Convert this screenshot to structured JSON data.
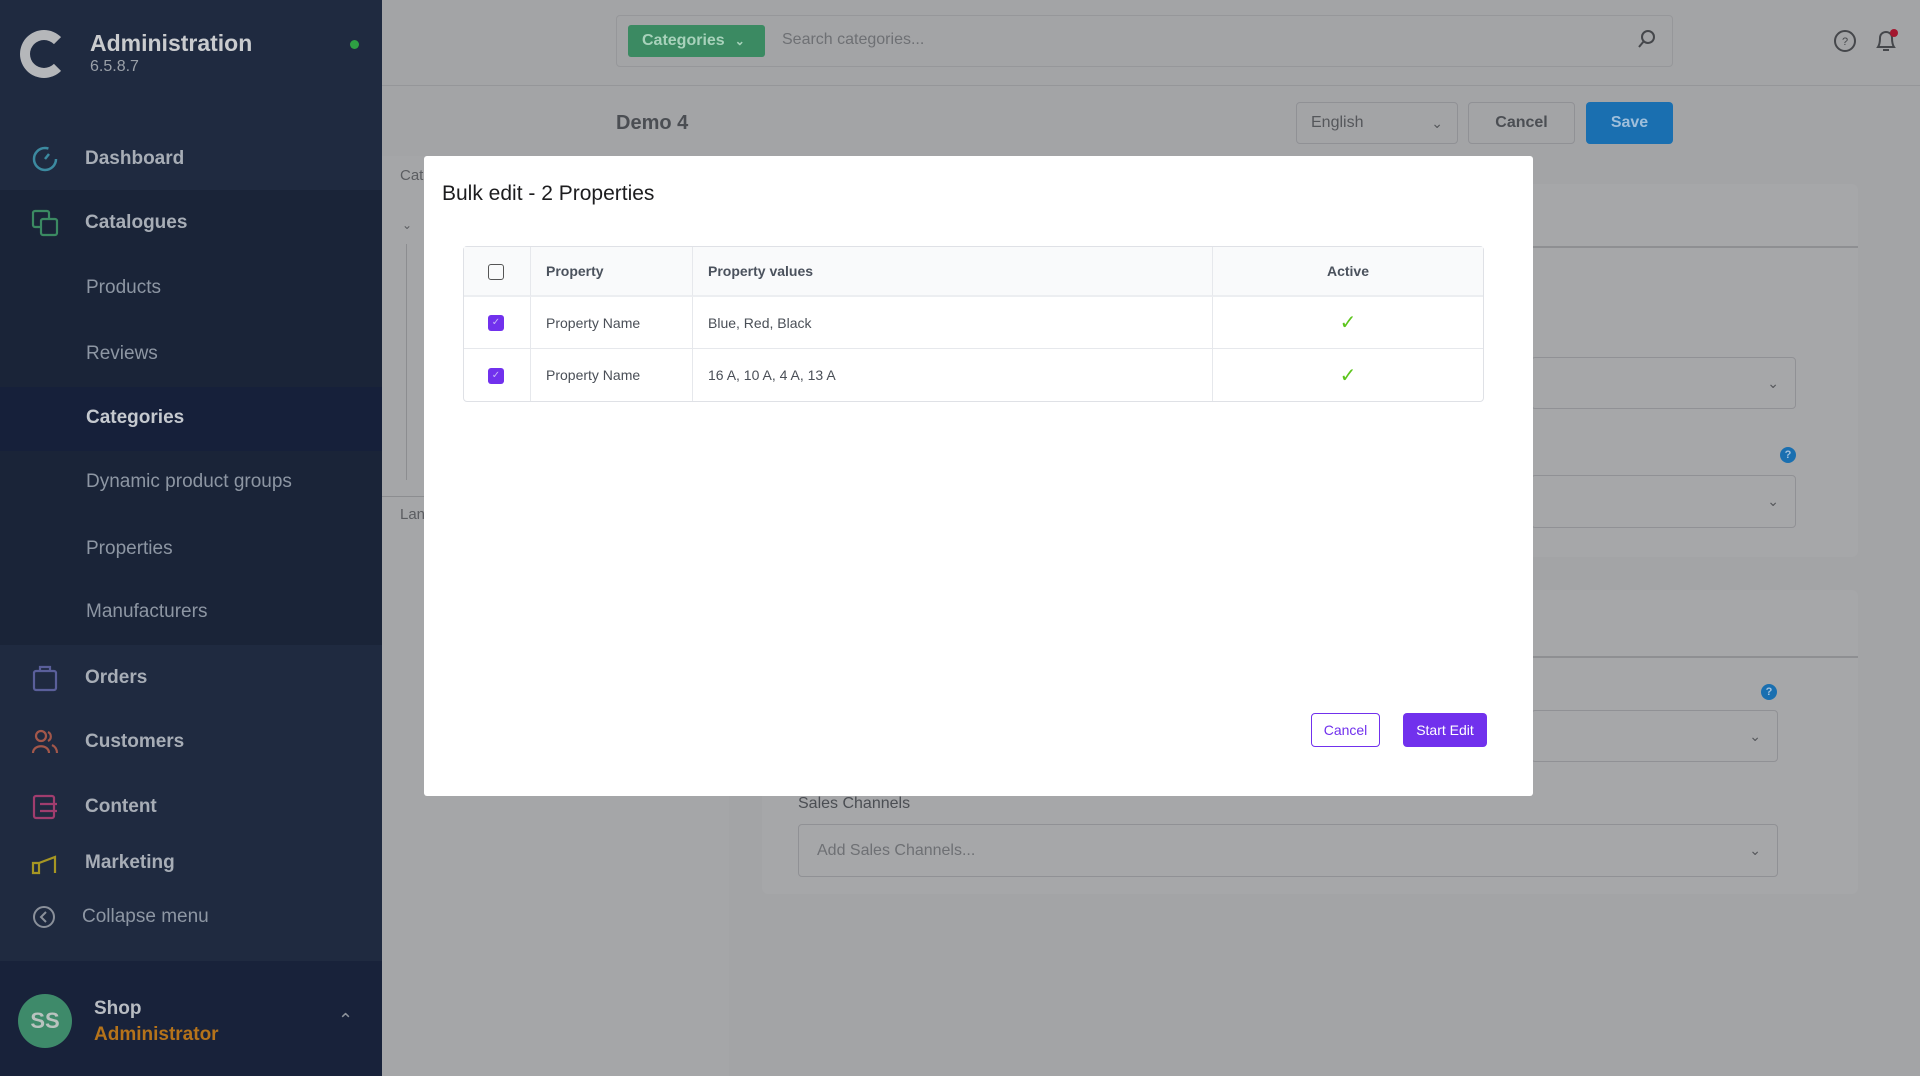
{
  "app": {
    "title": "Administration",
    "version": "6.5.8.7"
  },
  "sidebar": {
    "items": [
      {
        "label": "Dashboard",
        "icon": "dashboard-icon"
      },
      {
        "label": "Catalogues",
        "icon": "catalogues-icon"
      },
      {
        "label": "Products"
      },
      {
        "label": "Reviews"
      },
      {
        "label": "Categories",
        "active": true
      },
      {
        "label": "Dynamic product groups"
      },
      {
        "label": "Properties"
      },
      {
        "label": "Manufacturers"
      },
      {
        "label": "Orders",
        "icon": "orders-icon"
      },
      {
        "label": "Customers",
        "icon": "customers-icon"
      },
      {
        "label": "Content",
        "icon": "content-icon"
      },
      {
        "label": "Marketing",
        "icon": "marketing-icon"
      }
    ],
    "collapse_label": "Collapse menu"
  },
  "user": {
    "initials": "SS",
    "name": "Shop",
    "role": "Administrator"
  },
  "header": {
    "search_type": "Categories",
    "search_placeholder": "Search categories..."
  },
  "page": {
    "title": "Demo 4",
    "language": "English",
    "cancel_label": "Cancel",
    "save_label": "Save",
    "left_label_1": "Cat",
    "left_label_2": "Lan",
    "sales_channels_label": "Sales Channels",
    "sales_channels_placeholder": "Add Sales Channels..."
  },
  "modal": {
    "title": "Bulk edit - 2  Properties",
    "columns": [
      "Property",
      "Property values",
      "Active"
    ],
    "rows": [
      {
        "checked": true,
        "property": "Property Name",
        "values": "Blue, Red, Black",
        "active": true
      },
      {
        "checked": true,
        "property": "Property Name",
        "values": "16 A, 10 A, 4 A, 13 A",
        "active": true
      }
    ],
    "cancel_label": "Cancel",
    "start_label": "Start Edit"
  },
  "colors": {
    "accent": "#7131ed",
    "save": "#1a6fb0",
    "active_check": "#5cc51c",
    "sidebar": "#1f2a40"
  }
}
